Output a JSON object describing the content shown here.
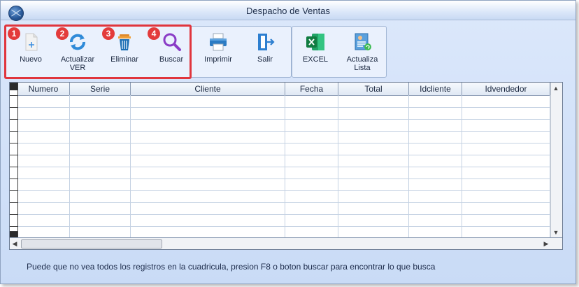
{
  "window": {
    "title": "Despacho de Ventas"
  },
  "toolbar": {
    "buttons": [
      {
        "label": "Nuevo",
        "badge": "1",
        "icon": "new-document-icon"
      },
      {
        "label": "Actualizar VER",
        "badge": "2",
        "icon": "refresh-icon"
      },
      {
        "label": "Eliminar",
        "badge": "3",
        "icon": "trash-icon"
      },
      {
        "label": "Buscar",
        "badge": "4",
        "icon": "search-icon"
      },
      {
        "label": "Imprimir",
        "icon": "printer-icon"
      },
      {
        "label": "Salir",
        "icon": "exit-door-icon"
      },
      {
        "label": "EXCEL",
        "icon": "excel-icon"
      },
      {
        "label": "Actualiza Lista",
        "icon": "update-list-icon"
      }
    ]
  },
  "grid": {
    "columns": [
      "Numero",
      "Serie",
      "Cliente",
      "Fecha",
      "Total",
      "Idcliente",
      "Idvendedor"
    ]
  },
  "status": {
    "message": "Puede que no vea todos los registros en la cuadricula, presion F8 o boton buscar para encontrar lo que busca"
  },
  "colors": {
    "highlight": "#e0353d",
    "badge": "#e33b3b",
    "accent": "#2a5b9c"
  }
}
